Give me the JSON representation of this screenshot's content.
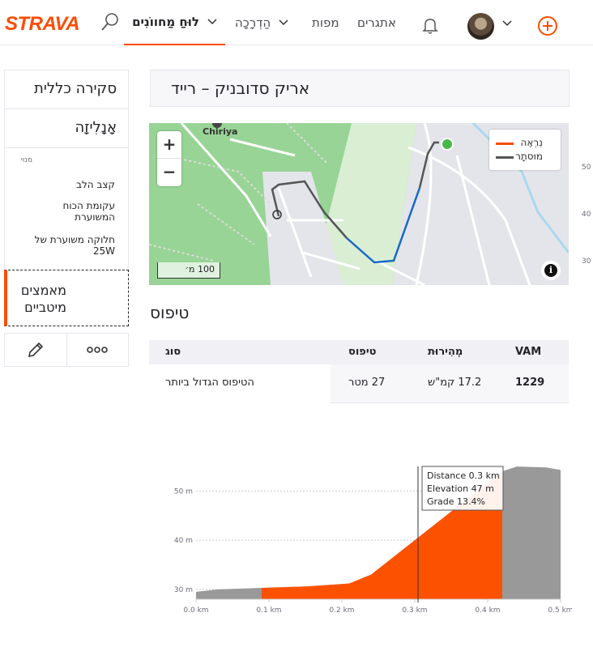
{
  "header": {
    "logo": "STRAVA",
    "nav": {
      "dashboard": "לוּחַ מַחווֹנִים",
      "training": "הַדְרָכָה",
      "maps": "מפות",
      "challenges": "אתגרים"
    },
    "colors": {
      "brand": "#fc4c02"
    }
  },
  "sidebar": {
    "overview": "סקירה כללית",
    "analysis": "אָנָלִיזָה",
    "premium_label": "מנוי",
    "sub_items": [
      "קצב הלב",
      "עקומת הכוח המשוערת",
      "חלוקה משוערת של 25W"
    ],
    "segment_efforts": "מאמצים מיטביים"
  },
  "activity": {
    "title": "אריק סדובניק – רייד"
  },
  "map": {
    "place_label": "Chiriya",
    "zoom_in": "+",
    "zoom_out": "−",
    "legend_shown": "נִרְאֶה",
    "legend_hidden": "מוּסתָר",
    "scale": "100 מ׳",
    "info": "i",
    "right_ticks": [
      "50",
      "40",
      "30"
    ]
  },
  "climb": {
    "heading": "טיפוס",
    "columns": {
      "type": "סוג",
      "climb": "טיפוס",
      "speed": "מְהִירוּת",
      "vam": "VAM"
    },
    "row": {
      "type": "הטיפוס הגדול ביותר",
      "climb": "27 מטר",
      "speed": "17.2 קמ\"ש",
      "vam": "1229"
    }
  },
  "chart_data": {
    "type": "area",
    "x_unit": "km",
    "y_unit": "m",
    "xlim": [
      0,
      0.5
    ],
    "ylim": [
      28,
      56
    ],
    "x_ticks": [
      "0.0 km",
      "0.1 km",
      "0.2 km",
      "0.3 km",
      "0.4 km",
      "0.5 km"
    ],
    "y_ticks": [
      "50 m",
      "40 m",
      "30 m"
    ],
    "profile": [
      {
        "x": 0.0,
        "y": 29.5
      },
      {
        "x": 0.03,
        "y": 30.0
      },
      {
        "x": 0.09,
        "y": 30.3
      },
      {
        "x": 0.15,
        "y": 30.6
      },
      {
        "x": 0.21,
        "y": 31.2
      },
      {
        "x": 0.24,
        "y": 33.0
      },
      {
        "x": 0.3,
        "y": 40.0
      },
      {
        "x": 0.36,
        "y": 47.0
      },
      {
        "x": 0.42,
        "y": 54.0
      },
      {
        "x": 0.44,
        "y": 55.0
      },
      {
        "x": 0.48,
        "y": 54.8
      },
      {
        "x": 0.5,
        "y": 54.3
      }
    ],
    "highlight_range": [
      0.09,
      0.42
    ],
    "grid": true,
    "tooltip": {
      "distance_label": "Distance",
      "distance": "0.3 km",
      "elevation_label": "Elevation",
      "elevation": "47 m",
      "grade_label": "Grade",
      "grade": "13.4%"
    },
    "colors": {
      "highlight": "#fc5200",
      "base": "#999999"
    }
  }
}
